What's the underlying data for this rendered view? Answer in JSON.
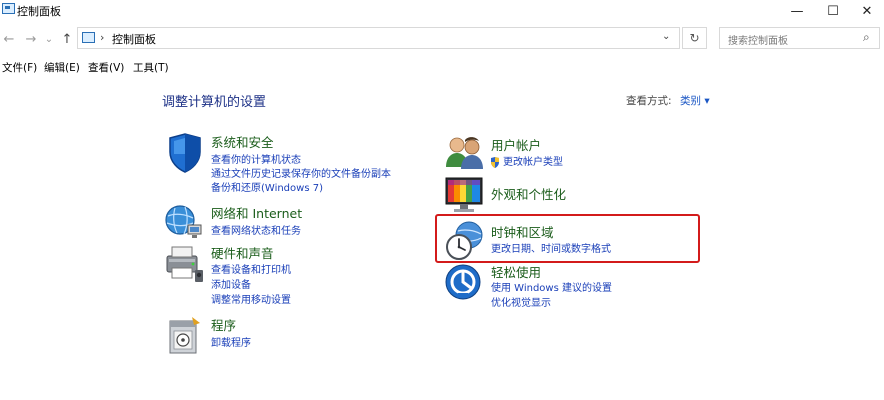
{
  "window": {
    "title": "控制面板",
    "minimize": "—",
    "maximize": "☐",
    "close": "✕"
  },
  "nav": {
    "back": "←",
    "forward": "→",
    "dropdown": "⌄",
    "up": "↑"
  },
  "address": {
    "separator": "›",
    "path": "控制面板",
    "dropdown": "⌄",
    "refresh": "↻"
  },
  "search": {
    "placeholder": "搜索控制面板",
    "icon": "⌕"
  },
  "menu": [
    "文件(F)",
    "编辑(E)",
    "查看(V)",
    "工具(T)"
  ],
  "content": {
    "heading": "调整计算机的设置",
    "view_by_label": "查看方式:",
    "view_by_value": "类别 ▾"
  },
  "categories": {
    "system": {
      "title": "系统和安全",
      "links": [
        "查看你的计算机状态",
        "通过文件历史记录保存你的文件备份副本",
        "备份和还原(Windows 7)"
      ]
    },
    "network": {
      "title": "网络和 Internet",
      "links": [
        "查看网络状态和任务"
      ]
    },
    "hardware": {
      "title": "硬件和声音",
      "links": [
        "查看设备和打印机",
        "添加设备",
        "调整常用移动设置"
      ]
    },
    "programs": {
      "title": "程序",
      "links": [
        "卸载程序"
      ]
    },
    "users": {
      "title": "用户帐户",
      "links": [
        "更改帐户类型"
      ]
    },
    "appearance": {
      "title": "外观和个性化",
      "links": []
    },
    "clock": {
      "title": "时钟和区域",
      "links": [
        "更改日期、时间或数字格式"
      ]
    },
    "ease": {
      "title": "轻松使用",
      "links": [
        "使用 Windows 建议的设置",
        "优化视觉显示"
      ]
    }
  },
  "colors": {
    "heading": "#1e3287",
    "category_title": "#1a5c1a",
    "link": "#1a3fb8",
    "highlight_border": "#d31b1b"
  }
}
